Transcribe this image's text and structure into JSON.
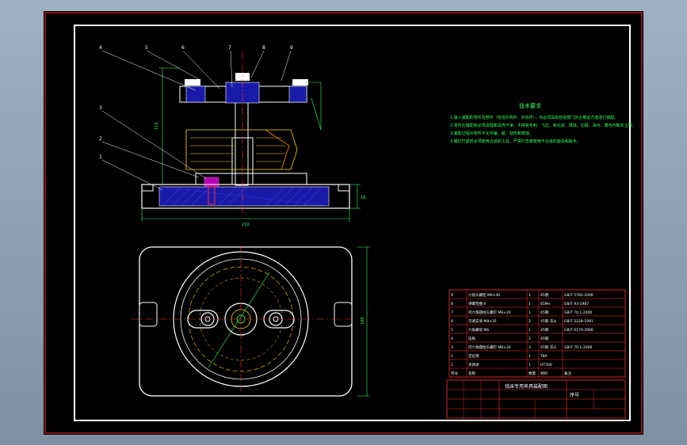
{
  "drawing": {
    "part_numbers": [
      "4",
      "5",
      "6",
      "7",
      "8",
      "9",
      "3",
      "2",
      "1"
    ],
    "dimensions": {
      "height": "110",
      "width": "210",
      "base_thickness": "18",
      "plan_height": "180"
    },
    "tech_req": {
      "title": "技术要求",
      "lines": [
        "1.装入装配的零件及部件（包括外购件、外协件），均必须具有检验部门的合格证方能进行装配。",
        "2.零件在装配前必须清理和清洗干净，不得有毛刺、飞边、氧化皮、锈蚀、切屑、油污、着色剂和灰尘等。",
        "3.装配过程中零件不允许磕、碰、划伤和锈蚀。",
        "4.螺钉拧紧时必须使用合适的工具，严禁打击或使用不合适的旋具和扳手。"
      ]
    },
    "bom": [
      {
        "no": "9",
        "name": "六角头螺栓 M6×40",
        "qty": "1",
        "mat": "45钢",
        "std": "GB/T 5782-2000"
      },
      {
        "no": "8",
        "name": "弹簧垫圈 6",
        "qty": "1",
        "mat": "65Mn",
        "std": "GB/T 93-1987"
      },
      {
        "no": "7",
        "name": "内六角圆柱头螺钉 M6×20",
        "qty": "1",
        "mat": "45钢",
        "std": "GB/T 70.1-2000"
      },
      {
        "no": "6",
        "name": "可调支承 M8×35",
        "qty": "2",
        "mat": "45钢 淬火",
        "std": "GB/T 2228-1991"
      },
      {
        "no": "5",
        "name": "六角螺母 M6",
        "qty": "1",
        "mat": "45钢",
        "std": "GB/T 6170-2000"
      },
      {
        "no": "4",
        "name": "压板",
        "qty": "2",
        "mat": "45钢",
        "std": ""
      },
      {
        "no": "3",
        "name": "内六角圆柱头螺钉 M8×20",
        "qty": "3",
        "mat": "45钢 淬火",
        "std": "GB/T 70.1-2000"
      },
      {
        "no": "2",
        "name": "定位销",
        "qty": "1",
        "mat": "T8A",
        "std": ""
      },
      {
        "no": "1",
        "name": "夹具体",
        "qty": "1",
        "mat": "HT200",
        "std": ""
      }
    ],
    "bom_header": {
      "no": "序号",
      "name": "名称",
      "qty": "数量",
      "mat": "材料",
      "std": "备注"
    },
    "title_block": {
      "title": "铣床专用夹具装配图",
      "no_label": "序号"
    }
  }
}
